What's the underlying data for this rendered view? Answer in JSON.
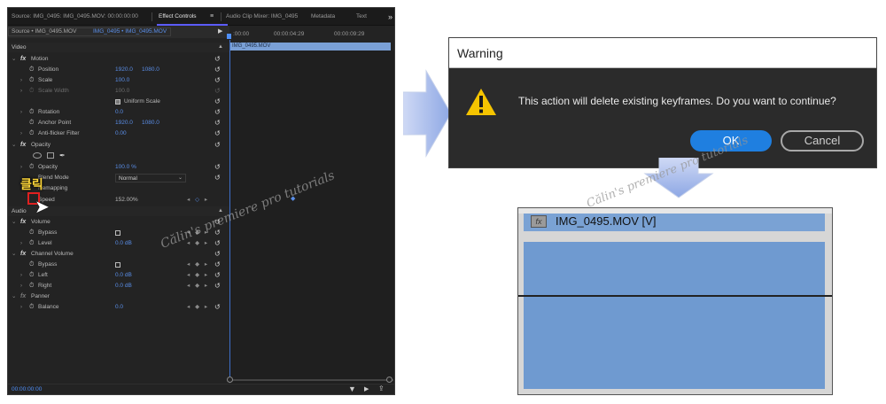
{
  "panel": {
    "tabs": [
      "Source: IMG_0495: IMG_0495.MOV: 00:00:00:00",
      "Effect Controls",
      "Audio Clip Mixer: IMG_0495",
      "Metadata",
      "Text"
    ],
    "tab_menu": "≡",
    "tab_more": "»",
    "source_left": "Source • IMG_0495.MOV",
    "source_right": "IMG_0495 • IMG_0495.MOV",
    "ruler_times": [
      ":00:00",
      "00:00:04:29",
      "00:00:09:29"
    ],
    "clip_label": "IMG_0495.MOV",
    "sections": {
      "video": "Video",
      "audio": "Audio"
    },
    "rows": {
      "motion": "Motion",
      "position": "Position",
      "position_x": "1920.0",
      "position_y": "1080.0",
      "scale": "Scale",
      "scale_val": "100.0",
      "scale_width": "Scale Width",
      "scale_width_val": "100.0",
      "uniform_scale": "Uniform Scale",
      "rotation": "Rotation",
      "rotation_val": "0.0",
      "anchor": "Anchor Point",
      "anchor_x": "1920.0",
      "anchor_y": "1080.0",
      "antiflicker": "Anti-flicker Filter",
      "antiflicker_val": "0.00",
      "opacity": "Opacity",
      "opacity_prop": "Opacity",
      "opacity_val": "100.0 %",
      "blend_mode": "Blend Mode",
      "blend_val": "Normal",
      "time_remap": "Remapping",
      "speed": "Speed",
      "speed_val": "152.00%",
      "volume": "Volume",
      "bypass": "Bypass",
      "level": "Level",
      "level_val": "0.0 dB",
      "channel_volume": "Channel Volume",
      "bypass2": "Bypass",
      "left": "Left",
      "left_val": "0.0 dB",
      "right": "Right",
      "right_val": "0.0 dB",
      "panner": "Panner",
      "balance": "Balance",
      "balance_val": "0.0"
    },
    "korean_label": "클릭",
    "timecode": "00:00:00:00",
    "watermark": "Călin's premiere pro tutorials"
  },
  "dialog": {
    "title": "Warning",
    "message": "This action will delete existing keyframes. Do you want to continue?",
    "ok": "OK",
    "cancel": "Cancel"
  },
  "clip_zoom": {
    "fx": "fx",
    "name": "IMG_0495.MOV [V]"
  },
  "watermark2": "Călin's premiere pro tutorials",
  "colors": {
    "accent_blue": "#1f7fe0",
    "clip_blue": "#6f9ad0",
    "panel_bg": "#232323",
    "warning_yellow": "#f5c400",
    "value_blue": "#5a8ee8"
  }
}
